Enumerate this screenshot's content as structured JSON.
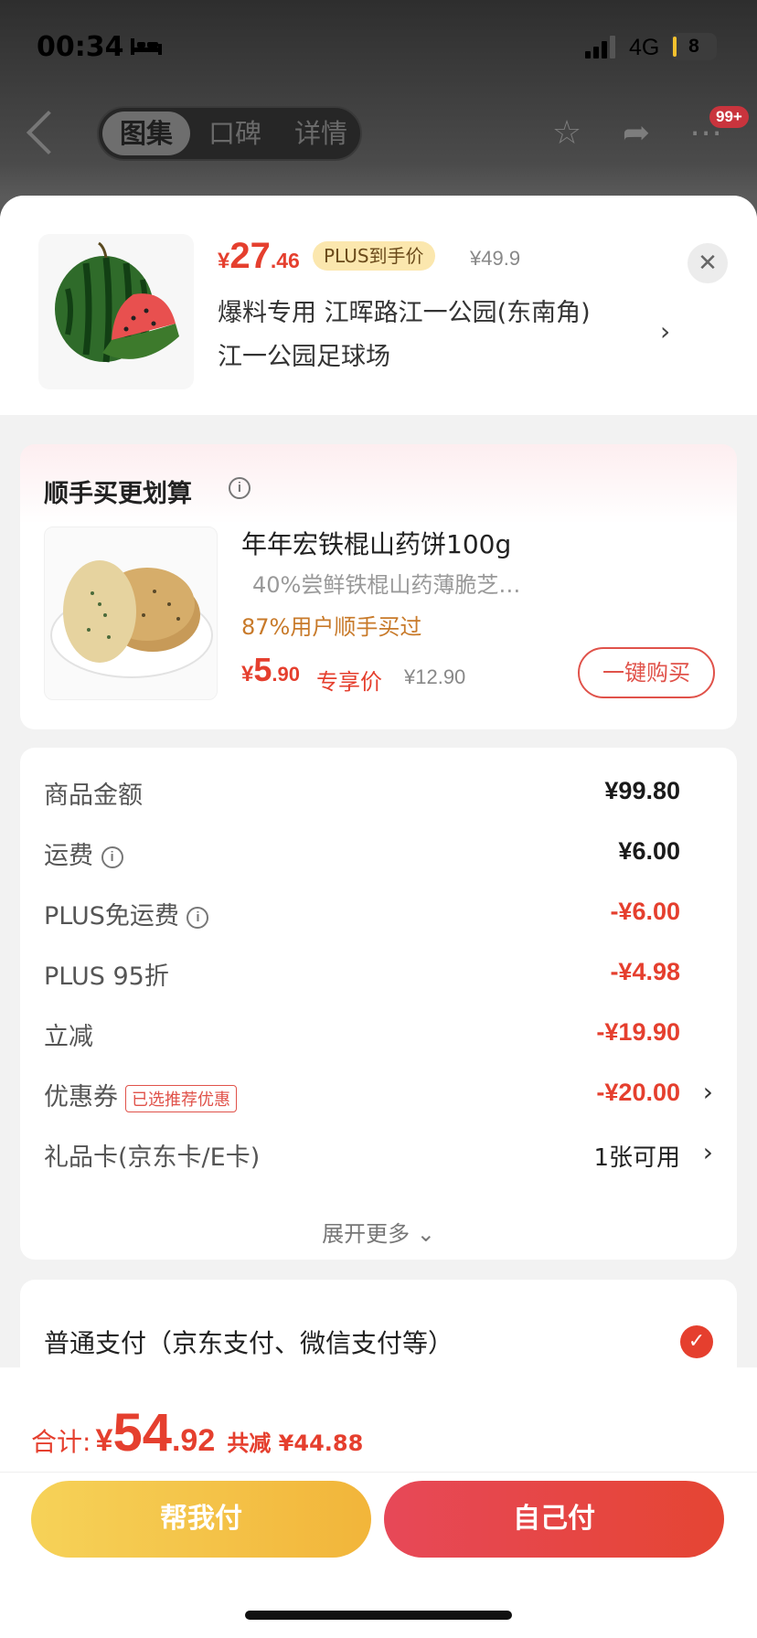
{
  "status_bar": {
    "time": "00:34",
    "network": "4G",
    "battery": "8"
  },
  "nav": {
    "tabs": [
      "图集",
      "口碑",
      "详情"
    ],
    "active_tab": "图集",
    "badge": "99+"
  },
  "product": {
    "price_symbol": "¥",
    "price_int": "27",
    "price_dec": ".46",
    "plus_tag": "PLUS到手价",
    "original_price": "¥49.9",
    "address_line1": "爆料专用  江晖路江一公园(东南角)",
    "address_line2": "江一公园足球场",
    "image_icon": "watermelon"
  },
  "upsell": {
    "section_title": "顺手买更划算",
    "name": "年年宏铁棍山药饼100g",
    "desc": "40%尝鲜铁棍山药薄脆芝…",
    "stat": "87%用户顺手买过",
    "price_symbol": "¥",
    "price_int": "5",
    "price_dec": ".90",
    "exclusive_label": "专享价",
    "original_price": "¥12.90",
    "buy_button": "一键购买",
    "image_icon": "yam-crackers"
  },
  "summary": {
    "rows": [
      {
        "label": "商品金额",
        "value": "¥99.80",
        "tone": "black"
      },
      {
        "label": "运费",
        "value": "¥6.00",
        "tone": "black"
      },
      {
        "label": "PLUS免运费",
        "value": "-¥6.00",
        "tone": "red"
      },
      {
        "label": "PLUS 95折",
        "value": "-¥4.98",
        "tone": "red"
      },
      {
        "label": "立减",
        "value": "-¥19.90",
        "tone": "red"
      },
      {
        "label": "优惠券",
        "tag": "已选推荐优惠",
        "value": "-¥20.00",
        "tone": "red"
      },
      {
        "label": "礼品卡(京东卡/E卡)",
        "value": "1张可用",
        "tone": "plain"
      }
    ],
    "expand_label": "展开更多"
  },
  "payment": {
    "method_label": "普通支付（京东支付、微信支付等）",
    "selected": true
  },
  "footer": {
    "total_label": "合计:",
    "total_symbol": "¥",
    "total_int": "54",
    "total_dec": ".92",
    "saved_text": "共减 ¥44.88",
    "help_pay_button": "帮我付",
    "self_pay_button": "自己付"
  },
  "colors": {
    "accent_red": "#e53f2e",
    "gold_start": "#f6d258",
    "gold_end": "#f2b53a"
  }
}
